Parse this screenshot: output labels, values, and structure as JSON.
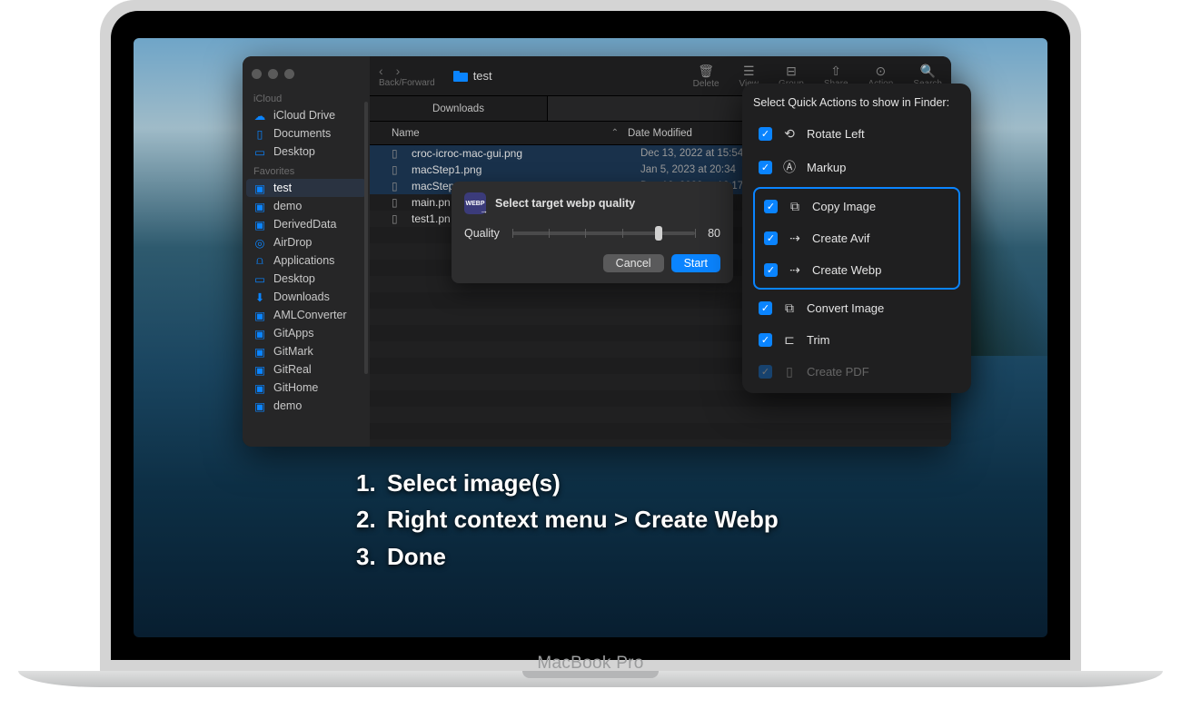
{
  "laptop_label": "MacBook Pro",
  "finder": {
    "location": "test",
    "nav_label": "Back/Forward",
    "toolbar_actions": {
      "delete": "Delete",
      "view": "View",
      "group": "Group",
      "share": "Share",
      "action": "Action",
      "search": "Search"
    },
    "tab": "Downloads",
    "columns": {
      "name": "Name",
      "date": "Date Modified"
    },
    "sidebar": {
      "icloud_label": "iCloud",
      "icloud": [
        {
          "label": "iCloud Drive",
          "icon": "cloud"
        },
        {
          "label": "Documents",
          "icon": "doc"
        },
        {
          "label": "Desktop",
          "icon": "desktop"
        }
      ],
      "favorites_label": "Favorites",
      "favorites": [
        {
          "label": "test",
          "icon": "folder",
          "active": true
        },
        {
          "label": "demo",
          "icon": "folder"
        },
        {
          "label": "DerivedData",
          "icon": "folder"
        },
        {
          "label": "AirDrop",
          "icon": "airdrop"
        },
        {
          "label": "Applications",
          "icon": "apps"
        },
        {
          "label": "Desktop",
          "icon": "desktop"
        },
        {
          "label": "Downloads",
          "icon": "download"
        },
        {
          "label": "AMLConverter",
          "icon": "folder"
        },
        {
          "label": "GitApps",
          "icon": "folder"
        },
        {
          "label": "GitMark",
          "icon": "folder"
        },
        {
          "label": "GitReal",
          "icon": "folder"
        },
        {
          "label": "GitHome",
          "icon": "folder"
        },
        {
          "label": "demo",
          "icon": "folder"
        }
      ]
    },
    "files": [
      {
        "name": "croc-icroc-mac-gui.png",
        "date": "Dec 13, 2022 at 15:54",
        "selected": true
      },
      {
        "name": "macStep1.png",
        "date": "Jan 5, 2023 at 20:34",
        "selected": true
      },
      {
        "name": "macStep2.png",
        "date": "Dec 12, 2022 at 16:17",
        "selected": true
      },
      {
        "name": "main.pn",
        "date": ""
      },
      {
        "name": "test1.pn",
        "date": ""
      }
    ]
  },
  "quality_modal": {
    "badge": "WEBP",
    "title": "Select target webp quality",
    "quality_label": "Quality",
    "value": "80",
    "cancel": "Cancel",
    "start": "Start"
  },
  "popover": {
    "title": "Select Quick Actions to show in Finder:",
    "items": [
      {
        "label": "Rotate Left",
        "checked": true,
        "group": 0
      },
      {
        "label": "Markup",
        "checked": true,
        "group": 0
      },
      {
        "label": "Copy Image",
        "checked": true,
        "group": 1
      },
      {
        "label": "Create Avif",
        "checked": true,
        "group": 1
      },
      {
        "label": "Create Webp",
        "checked": true,
        "group": 1
      },
      {
        "label": "Convert Image",
        "checked": true,
        "group": 2
      },
      {
        "label": "Trim",
        "checked": true,
        "group": 3
      },
      {
        "label": "Create PDF",
        "checked": true,
        "group": 4,
        "faded": true
      }
    ]
  },
  "instructions": [
    "Select image(s)",
    "Right context menu > Create Webp",
    "Done"
  ]
}
